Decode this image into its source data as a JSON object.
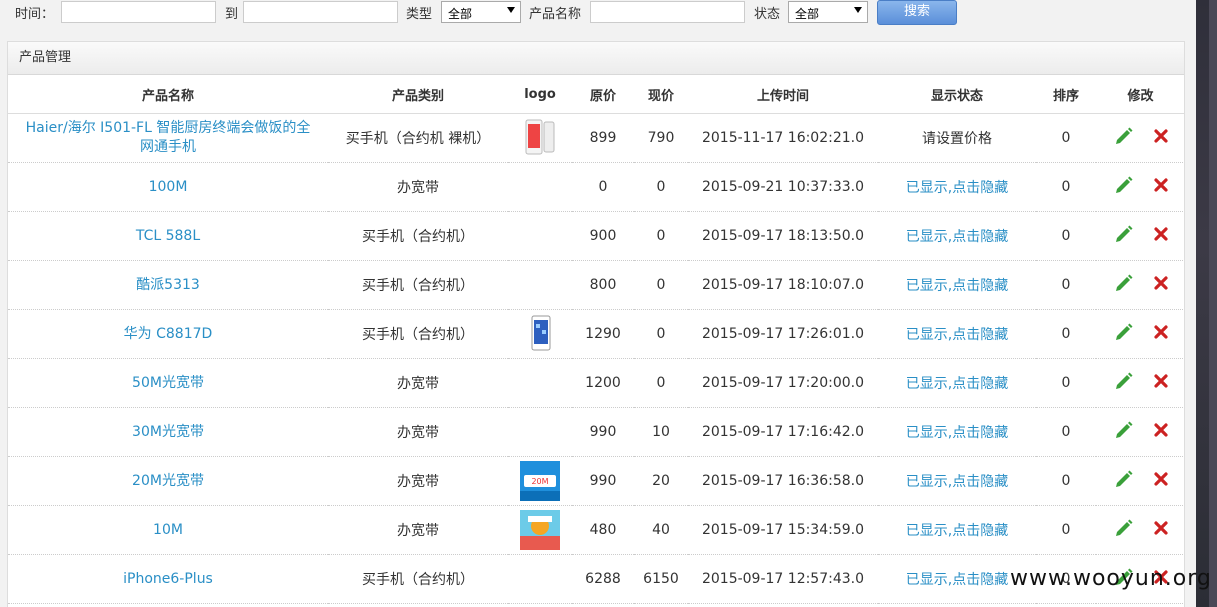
{
  "filters": {
    "time_label": "时间：",
    "to_label": "到",
    "type_label": "类型",
    "type_value": "全部",
    "product_name_label": "产品名称",
    "status_label": "状态",
    "status_value": "全部",
    "search_button": "搜索"
  },
  "panel": {
    "title": "产品管理"
  },
  "table": {
    "headers": [
      "产品名称",
      "产品类别",
      "logo",
      "原价",
      "现价",
      "上传时间",
      "显示状态",
      "排序",
      "修改"
    ],
    "rows": [
      {
        "name": "Haier/海尔 I501-FL 智能厨房终端会做饭的全网通手机",
        "category": "买手机（合约机 裸机）",
        "logo": "phone-white",
        "orig": "899",
        "cur": "790",
        "time": "2015-11-17 16:02:21.0",
        "status": "请设置价格",
        "status_link": false,
        "sort": "0"
      },
      {
        "name": "100M",
        "category": "办宽带",
        "logo": "",
        "orig": "0",
        "cur": "0",
        "time": "2015-09-21 10:37:33.0",
        "status": "已显示,点击隐藏",
        "status_link": true,
        "sort": "0"
      },
      {
        "name": "TCL 588L",
        "category": "买手机（合约机）",
        "logo": "",
        "orig": "900",
        "cur": "0",
        "time": "2015-09-17 18:13:50.0",
        "status": "已显示,点击隐藏",
        "status_link": true,
        "sort": "0"
      },
      {
        "name": "酷派5313",
        "category": "买手机（合约机）",
        "logo": "",
        "orig": "800",
        "cur": "0",
        "time": "2015-09-17 18:10:07.0",
        "status": "已显示,点击隐藏",
        "status_link": true,
        "sort": "0"
      },
      {
        "name": "华为 C8817D",
        "category": "买手机（合约机）",
        "logo": "phone-blue",
        "orig": "1290",
        "cur": "0",
        "time": "2015-09-17 17:26:01.0",
        "status": "已显示,点击隐藏",
        "status_link": true,
        "sort": "0"
      },
      {
        "name": "50M光宽带",
        "category": "办宽带",
        "logo": "",
        "orig": "1200",
        "cur": "0",
        "time": "2015-09-17 17:20:00.0",
        "status": "已显示,点击隐藏",
        "status_link": true,
        "sort": "0"
      },
      {
        "name": "30M光宽带",
        "category": "办宽带",
        "logo": "",
        "orig": "990",
        "cur": "10",
        "time": "2015-09-17 17:16:42.0",
        "status": "已显示,点击隐藏",
        "status_link": true,
        "sort": "0"
      },
      {
        "name": "20M光宽带",
        "category": "办宽带",
        "logo": "banner-blue",
        "orig": "990",
        "cur": "20",
        "time": "2015-09-17 16:36:58.0",
        "status": "已显示,点击隐藏",
        "status_link": true,
        "sort": "0"
      },
      {
        "name": "10M",
        "category": "办宽带",
        "logo": "banner-color",
        "orig": "480",
        "cur": "40",
        "time": "2015-09-17 15:34:59.0",
        "status": "已显示,点击隐藏",
        "status_link": true,
        "sort": "0"
      },
      {
        "name": "iPhone6-Plus",
        "category": "买手机（合约机）",
        "logo": "",
        "orig": "6288",
        "cur": "6150",
        "time": "2015-09-17 12:57:43.0",
        "status": "已显示,点击隐藏",
        "status_link": true,
        "sort": "0"
      }
    ]
  },
  "watermark": "www.wooyun.org",
  "colors": {
    "link": "#2a8fc6",
    "edit": "#3aa03a",
    "delete": "#cc2222"
  }
}
